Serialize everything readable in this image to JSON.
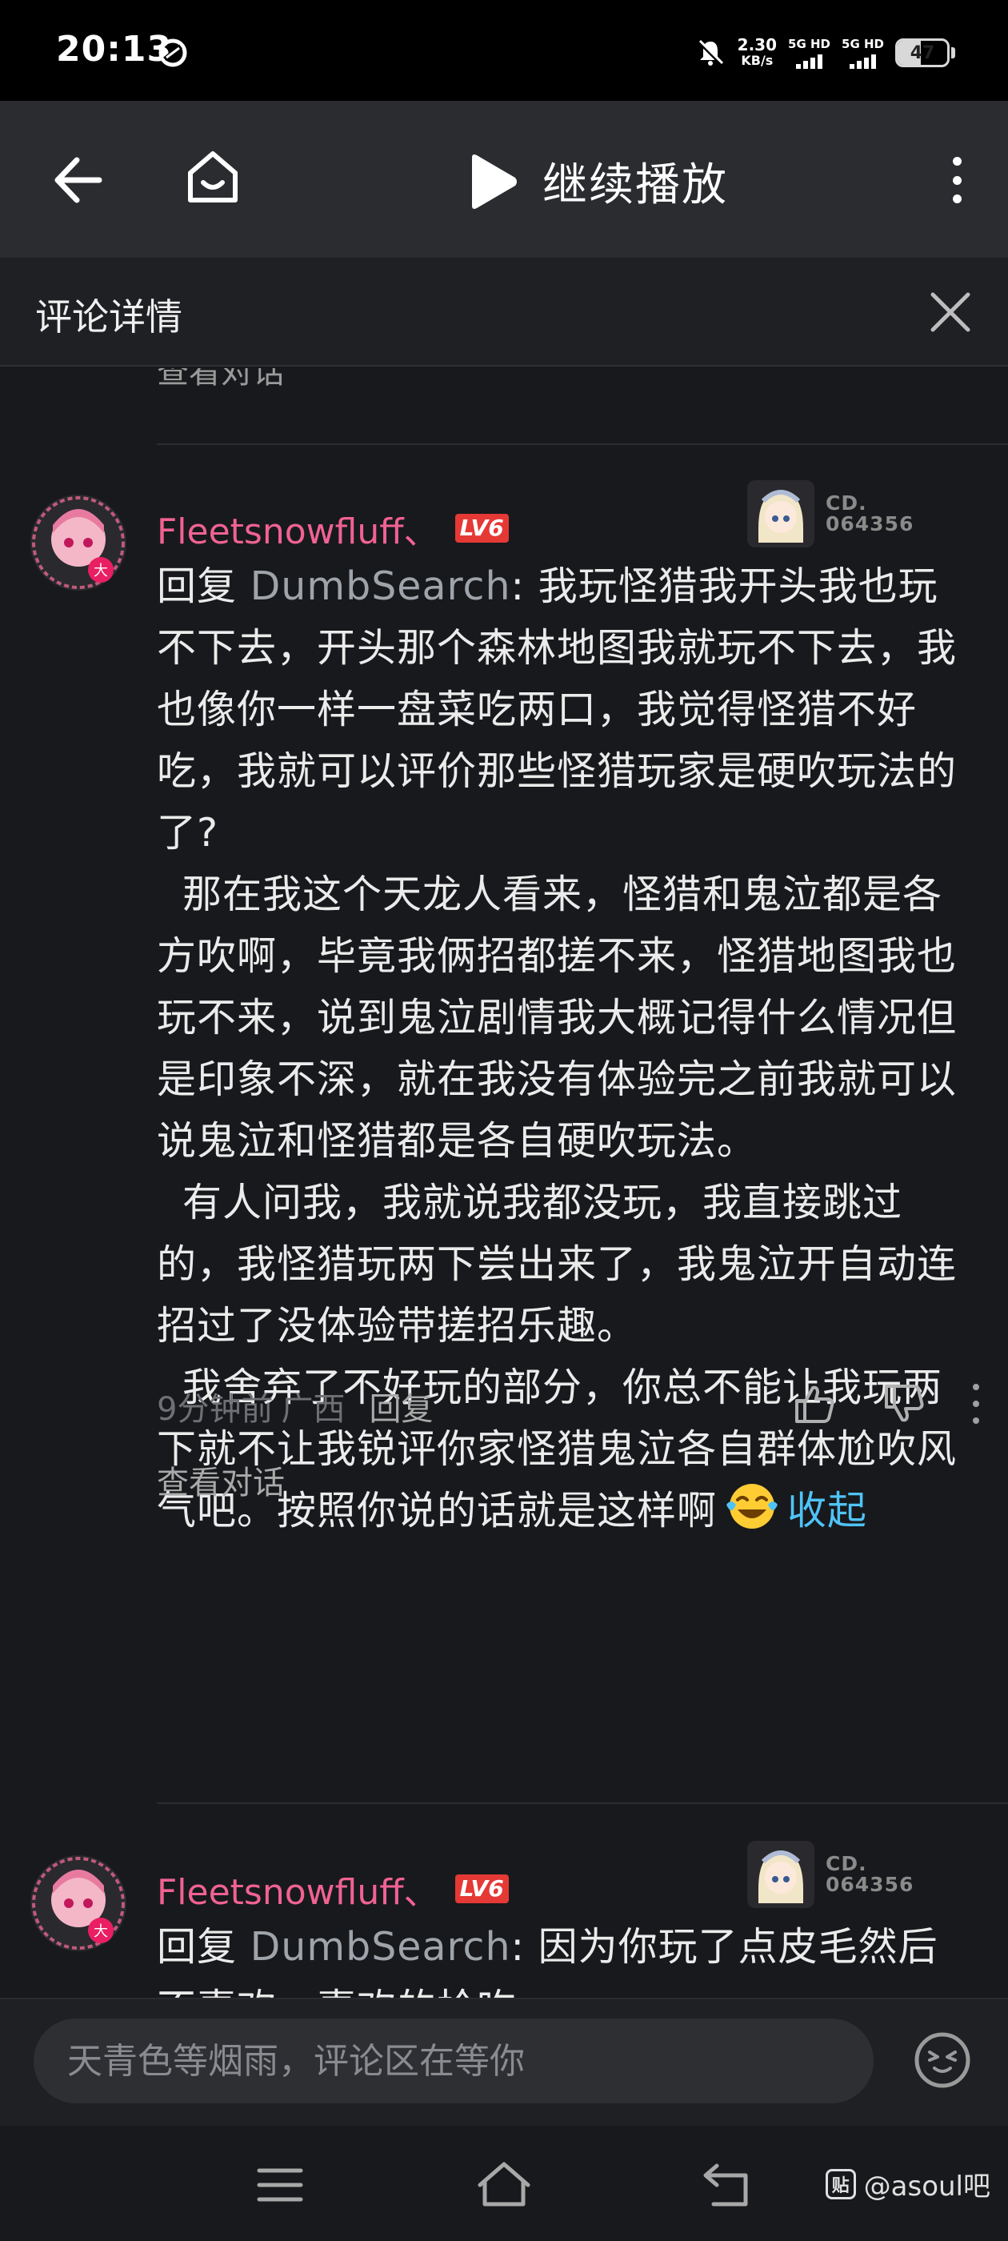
{
  "status_bar": {
    "time": "20:13",
    "net_speed_value": "2.30",
    "net_speed_unit": "KB/s",
    "sim1_label": "5G HD",
    "sim2_label": "5G HD",
    "battery": "47",
    "battery_level": 0.47
  },
  "nav": {
    "play_label": "继续播放"
  },
  "detail": {
    "title": "评论详情"
  },
  "previous": {
    "view_conversation": "查看对话"
  },
  "comments": [
    {
      "username": "Fleetsnowfluff、",
      "level": "LV6",
      "fan_no_line1": "CD.",
      "fan_no_line2": "064356",
      "reply_prefix": "回复 ",
      "reply_target": "DumbSearch",
      "reply_colon": ": ",
      "paragraphs": [
        "我玩怪猎我开头我也玩不下去，开头那个森林地图我就玩不下去，我也像你一样一盘菜吃两口，我觉得怪猎不好吃，我就可以评价那些怪猎玩家是硬吹玩法的了?",
        "那在我这个天龙人看来，怪猎和鬼泣都是各方吹啊，毕竟我俩招都搓不来，怪猎地图我也玩不来，说到鬼泣剧情我大概记得什么情况但是印象不深，就在我没有体验完之前我就可以说鬼泣和怪猎都是各自硬吹玩法。",
        "有人问我，我就说我都没玩，我直接跳过的，我怪猎玩两下尝出来了，我鬼泣开自动连招过了没体验带搓招乐趣。",
        "我舍弃了不好玩的部分，你总不能让我玩两下就不让我锐评你家怪猎鬼泣各自群体尬吹风气吧。按照你说的话就是这样啊"
      ],
      "emoji": "laugh-cry",
      "collapse": "收起",
      "time": "9分钟前",
      "location": "广西",
      "reply_label": "回复",
      "view_conversation": "查看对话"
    },
    {
      "username": "Fleetsnowfluff、",
      "level": "LV6",
      "fan_no_line1": "CD.",
      "fan_no_line2": "064356",
      "reply_prefix": "回复 ",
      "reply_target": "DumbSearch",
      "reply_colon": ": ",
      "text": "因为你玩了点皮毛然后不喜欢，喜欢的抢吃"
    }
  ],
  "input": {
    "placeholder": "天青色等烟雨，评论区在等你"
  },
  "watermark": {
    "icon_text": "贴",
    "text": "@asoul吧"
  },
  "colors": {
    "background": "#18191c",
    "username": "#f06292",
    "link": "#4fc3f7",
    "level_badge": "#e53935"
  }
}
